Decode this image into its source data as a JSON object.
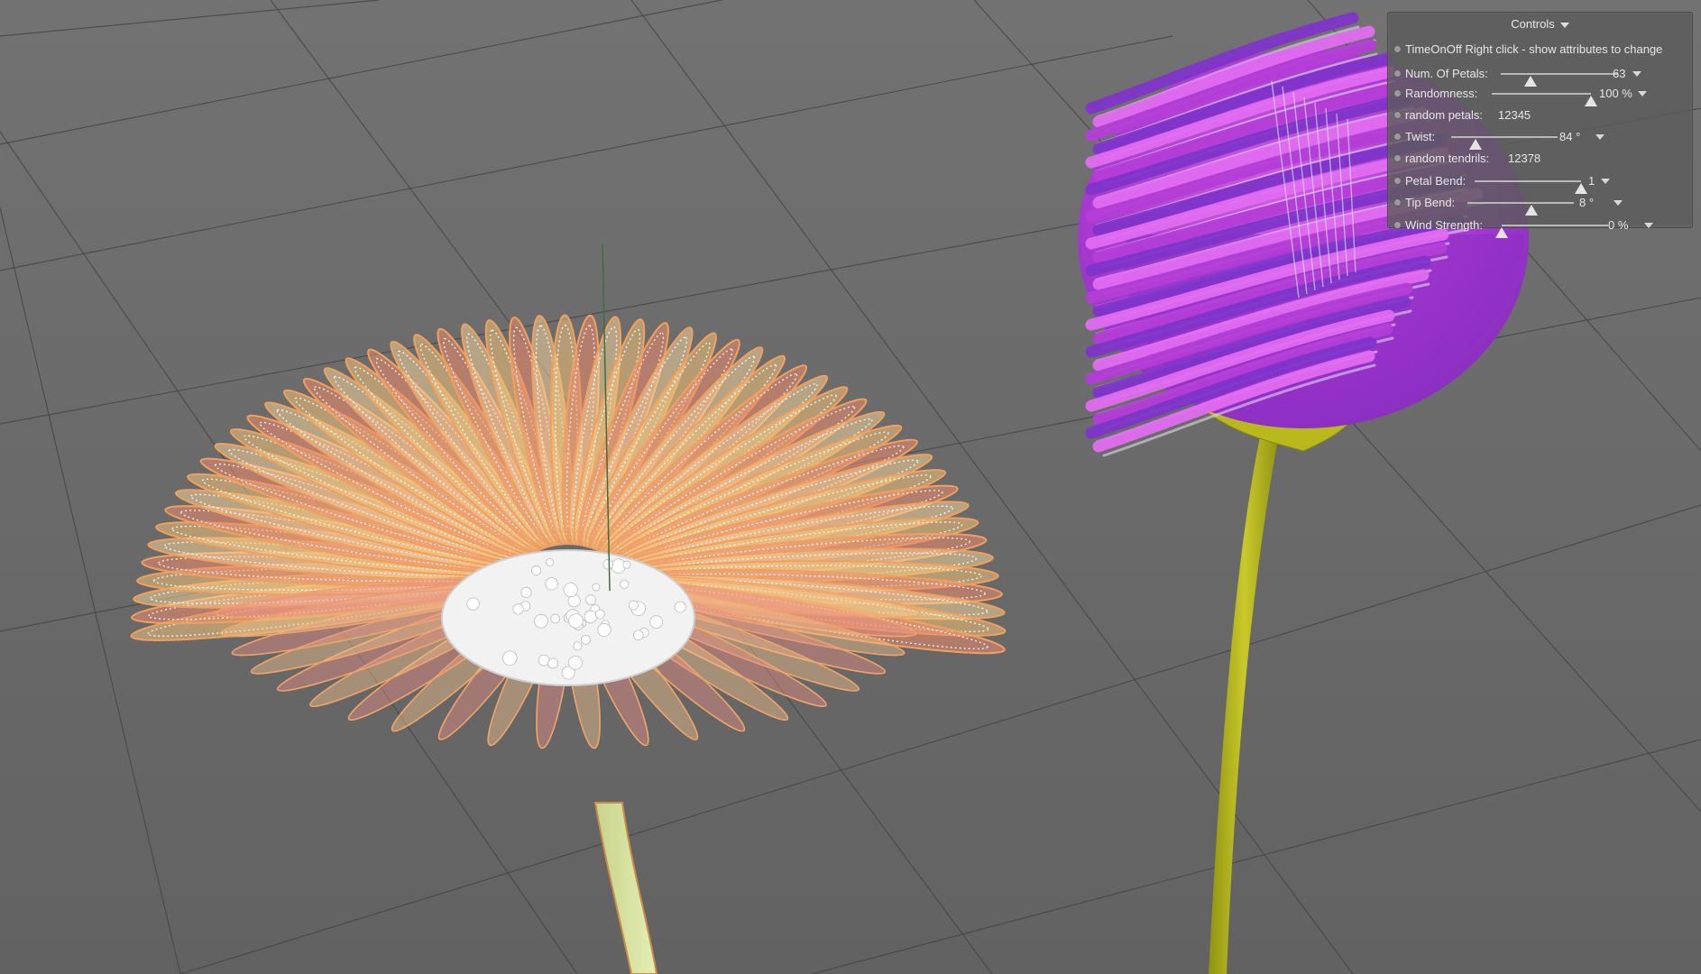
{
  "viewport": {
    "background_color": "#6e6e6e",
    "grid_color": "#454545"
  },
  "flowers": {
    "open_flower": {
      "mode": "wireframe",
      "colors": [
        "#f4c27a",
        "#f08c6e",
        "#ffffff"
      ]
    },
    "bud_flower": {
      "mode": "shaded",
      "colors": [
        "#b33dd6",
        "#7f34c9",
        "#c4c41e"
      ]
    }
  },
  "controls": {
    "title": "Controls",
    "time_row": {
      "label": "TimeOnOff Right click - show attributes to change"
    },
    "num_petals": {
      "label": "Num. Of Petals:",
      "value": "63",
      "level": 0.25
    },
    "randomness": {
      "label": "Randomness:",
      "value": "100 %",
      "level": 1.0
    },
    "random_petals": {
      "label": "random petals:",
      "value": "12345"
    },
    "twist": {
      "label": "Twist:",
      "value": "84 °",
      "level": 0.23
    },
    "random_tendrils": {
      "label": "random tendrils:",
      "value": "12378"
    },
    "petal_bend": {
      "label": "Petal Bend:",
      "value": "1",
      "level": 1.0
    },
    "tip_bend": {
      "label": "Tip Bend:",
      "value": "8 °",
      "level": 0.6
    },
    "wind_strength": {
      "label": "Wind Strength:",
      "value": "0 %",
      "level": 0.0
    }
  }
}
